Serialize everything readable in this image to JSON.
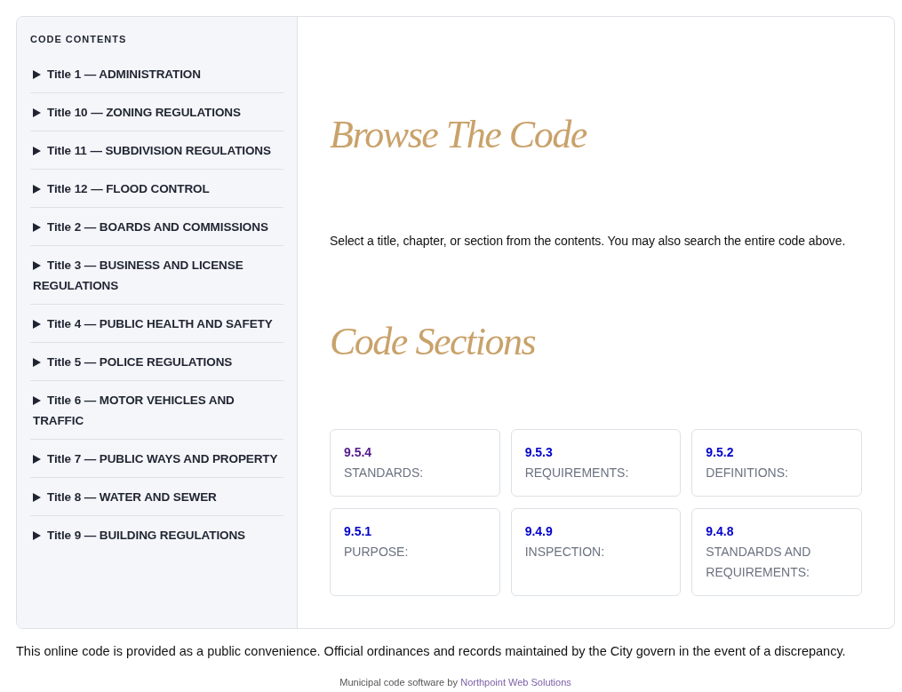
{
  "sidebar": {
    "heading": "CODE CONTENTS",
    "items": [
      {
        "label": "Title 1 — ADMINISTRATION",
        "expanded": false
      },
      {
        "label": "Title 10 — ZONING REGULATIONS",
        "expanded": false
      },
      {
        "label": "Title 11 — SUBDIVISION REGULATIONS",
        "expanded": false
      },
      {
        "label": "Title 12 — FLOOD CONTROL",
        "expanded": false
      },
      {
        "label": "Title 2 — BOARDS AND COMMISSIONS",
        "expanded": false
      },
      {
        "label": "Title 3 — BUSINESS AND LICENSE REGULATIONS",
        "expanded": false
      },
      {
        "label": "Title 4 — PUBLIC HEALTH AND SAFETY",
        "expanded": false
      },
      {
        "label": "Title 5 — POLICE REGULATIONS",
        "expanded": false
      },
      {
        "label": "Title 6 — MOTOR VEHICLES AND TRAFFIC",
        "expanded": false
      },
      {
        "label": "Title 7 — PUBLIC WAYS AND PROPERTY",
        "expanded": false
      },
      {
        "label": "Title 8 — WATER AND SEWER",
        "expanded": false
      },
      {
        "label": "Title 9 — BUILDING REGULATIONS",
        "expanded": false
      }
    ]
  },
  "main": {
    "title": "Browse The Code",
    "intro": "Select a title, chapter, or section from the contents. You may also search the entire code above.",
    "sections_heading": "Code Sections",
    "sections": [
      {
        "number": "9.5.4",
        "title": "STANDARDS:",
        "visited": true
      },
      {
        "number": "9.5.3",
        "title": "REQUIREMENTS:",
        "visited": false
      },
      {
        "number": "9.5.2",
        "title": "DEFINITIONS:",
        "visited": false
      },
      {
        "number": "9.5.1",
        "title": "PURPOSE:",
        "visited": false
      },
      {
        "number": "9.4.9",
        "title": "INSPECTION:",
        "visited": false
      },
      {
        "number": "9.4.8",
        "title": "STANDARDS AND REQUIREMENTS:",
        "visited": false
      }
    ]
  },
  "footer": {
    "notice": "This online code is provided as a public convenience. Official ordinances and records maintained by the City govern in the event of a discrepancy.",
    "credit": {
      "text": "Municipal code software by",
      "link": "Northpoint Web Solutions"
    }
  }
}
